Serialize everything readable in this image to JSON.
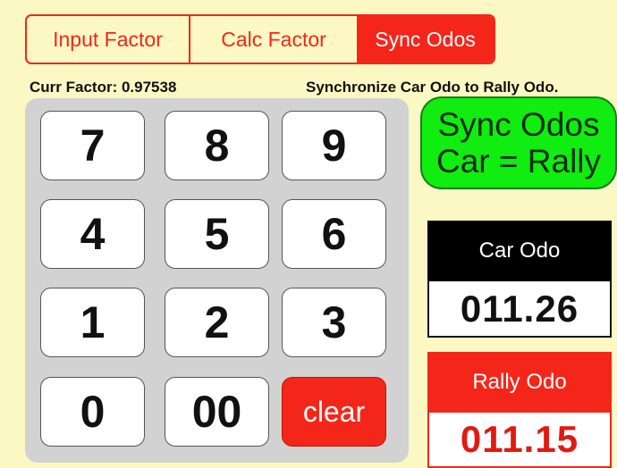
{
  "tabs": [
    {
      "label": "Input Factor",
      "active": false
    },
    {
      "label": "Calc Factor",
      "active": false
    },
    {
      "label": "Sync Odos",
      "active": true
    }
  ],
  "info": {
    "current_factor": "Curr Factor: 0.97538",
    "hint": "Synchronize Car Odo to Rally Odo."
  },
  "keypad": {
    "keys": [
      "7",
      "8",
      "9",
      "4",
      "5",
      "6",
      "1",
      "2",
      "3",
      "0",
      "00",
      "clear"
    ]
  },
  "sync_button": {
    "line1": "Sync Odos",
    "line2": "Car = Rally"
  },
  "car_odo": {
    "label": "Car Odo",
    "value": "011.26"
  },
  "rally_odo": {
    "label": "Rally Odo",
    "value": "011.15"
  },
  "colors": {
    "background": "#fbf8c4",
    "accent_red": "#f4261a",
    "sync_green": "#11ec11",
    "keypad_gray": "#d2d2d2"
  }
}
